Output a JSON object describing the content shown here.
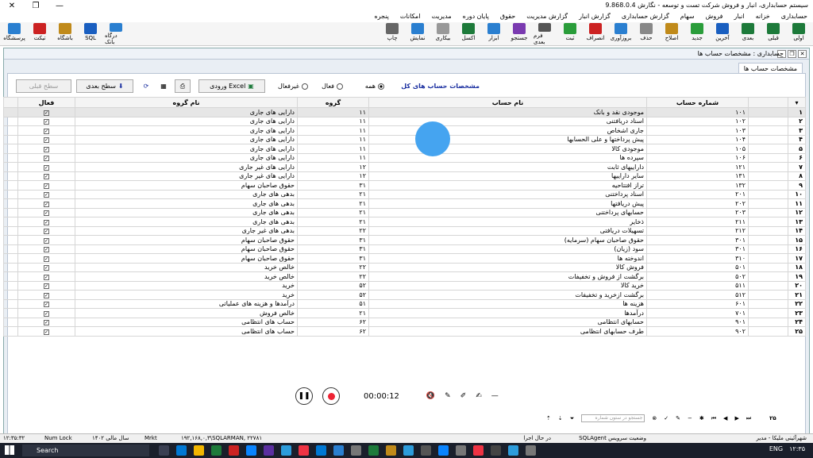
{
  "titlebar": {
    "title": "سیستم حسابداری، انبار و فروش شرکت تست و توسعه - نگارش 9.868.0.4"
  },
  "menu": [
    "حسابداری",
    "خزانه",
    "انبار",
    "فروش",
    "سهام",
    "گزارش حسابداری",
    "گزارش انبار",
    "گزارش مدیریت",
    "حقوق",
    "پایان دوره",
    "مدیریت",
    "امکانات",
    "پنجره"
  ],
  "toolbar": {
    "right": [
      "اولی",
      "قبلی",
      "بعدی",
      "آخرین",
      "جدید",
      "اصلاح",
      "حذف",
      "بروزآوری",
      "انصراف",
      "ثبت",
      "فرم بعدی",
      "جستجو",
      "ابزار",
      "اکسل",
      "بیکاری",
      "نمایش",
      "چاپ"
    ],
    "left": [
      "پرسشگاه",
      "تیکت",
      "باشگاه",
      "SQL",
      "درگاه بانک"
    ]
  },
  "window": {
    "title": "حسابداری : مشخصات حساب ها",
    "tab": "مشخصات حساب ها"
  },
  "options": {
    "header_link": "مشخصات حساب های کل",
    "all": "همه",
    "active": "فعال",
    "inactive": "غیرفعال",
    "import_excel": "ورودی Excel",
    "next_level": "سطح بعدی",
    "prev_level": "سطح قبلی"
  },
  "columns": {
    "account_no": "شماره حساب",
    "account_name": "نام حساب",
    "group": "گروه",
    "group_name": "نام گروه",
    "active": "فعال"
  },
  "rows": [
    {
      "n": "۱",
      "code": "۱۰۱",
      "name": "موجودی نقد و بانک",
      "grp": "۱۱",
      "gname": "دارایی های جاری",
      "sel": true
    },
    {
      "n": "۲",
      "code": "۱۰۲",
      "name": "اسناد دریافتنی",
      "grp": "۱۱",
      "gname": "دارایی های جاری"
    },
    {
      "n": "۳",
      "code": "۱۰۳",
      "name": "جاری اشخاص",
      "grp": "۱۱",
      "gname": "دارایی های جاری"
    },
    {
      "n": "۴",
      "code": "۱۰۴",
      "name": "پیش پرداختها و علی الحسابها",
      "grp": "۱۱",
      "gname": "دارایی های جاری"
    },
    {
      "n": "۵",
      "code": "۱۰۵",
      "name": "موجودی کالا",
      "grp": "۱۱",
      "gname": "دارایی های جاری"
    },
    {
      "n": "۶",
      "code": "۱۰۶",
      "name": "سپرده ها",
      "grp": "۱۱",
      "gname": "دارایی های جاری"
    },
    {
      "n": "۷",
      "code": "۱۲۱",
      "name": "داراییهای ثابت",
      "grp": "۱۲",
      "gname": "دارایی های غیر جاری"
    },
    {
      "n": "۸",
      "code": "۱۳۱",
      "name": "سایر داراییها",
      "grp": "۱۲",
      "gname": "دارایی های غیر جاری"
    },
    {
      "n": "۹",
      "code": "۱۳۲",
      "name": "تراز افتتاحیه",
      "grp": "۳۱",
      "gname": "حقوق صاحبان سهام"
    },
    {
      "n": "۱۰",
      "code": "۲۰۱",
      "name": "اسناد پرداختنی",
      "grp": "۲۱",
      "gname": "بدهی های جاری"
    },
    {
      "n": "۱۱",
      "code": "۲۰۲",
      "name": "پیش دریافتها",
      "grp": "۲۱",
      "gname": "بدهی های جاری"
    },
    {
      "n": "۱۲",
      "code": "۲۰۳",
      "name": "حسابهای پرداختنی",
      "grp": "۲۱",
      "gname": "بدهی های جاری"
    },
    {
      "n": "۱۳",
      "code": "۲۱۱",
      "name": "ذخایر",
      "grp": "۲۱",
      "gname": "بدهی های جاری"
    },
    {
      "n": "۱۴",
      "code": "۲۱۲",
      "name": "تسهیلات دریافتی",
      "grp": "۲۲",
      "gname": "بدهی های غیر جاری"
    },
    {
      "n": "۱۵",
      "code": "۳۰۱",
      "name": "حقوق صاحبان سهام (سرمایه)",
      "grp": "۳۱",
      "gname": "حقوق صاحبان سهام"
    },
    {
      "n": "۱۶",
      "code": "۳۰۱",
      "name": "سود (زیان)",
      "grp": "۳۱",
      "gname": "حقوق صاحبان سهام"
    },
    {
      "n": "۱۷",
      "code": "۳۱۰",
      "name": "اندوخته ها",
      "grp": "۳۱",
      "gname": "حقوق صاحبان سهام"
    },
    {
      "n": "۱۸",
      "code": "۵۰۱",
      "name": "فروش کالا",
      "grp": "۲۲",
      "gname": "خالص خرید"
    },
    {
      "n": "۱۹",
      "code": "۵۰۲",
      "name": "برگشت از فروش و تخفیفات",
      "grp": "۲۲",
      "gname": "خالص خرید"
    },
    {
      "n": "۲۰",
      "code": "۵۱۱",
      "name": "خرید کالا",
      "grp": "۵۲",
      "gname": "خرید"
    },
    {
      "n": "۲۱",
      "code": "۵۱۲",
      "name": "برگشت ازخرید و تخفیفات",
      "grp": "۵۲",
      "gname": "خرید"
    },
    {
      "n": "۲۲",
      "code": "۶۰۱",
      "name": "هزینه ها",
      "grp": "۵۱",
      "gname": "درآمدها و هزینه های عملیاتی"
    },
    {
      "n": "۲۳",
      "code": "۷۰۱",
      "name": "درآمدها",
      "grp": "۲۱",
      "gname": "خالص فروش"
    },
    {
      "n": "۲۴",
      "code": "۹۰۱",
      "name": "حسابهای انتظامی",
      "grp": "۶۲",
      "gname": "حساب های انتظامی"
    },
    {
      "n": "۲۵",
      "code": "۹۰۲",
      "name": "طرف حسابهای انتظامی",
      "grp": "۶۲",
      "gname": "حساب های انتظامی"
    }
  ],
  "player": {
    "time": "00:00:12"
  },
  "nav": {
    "count": "۲۵",
    "search_placeholder": "جستجو در ستون شماره"
  },
  "status": {
    "user": "شهرآئینی ملیکا - مدیر",
    "sql": "SQLAgent وضعیت سرویس",
    "run": "در حال اجرا",
    "server": "۱۹۲,۱۶۸,۰,۳\\SQLARMAN, ۲۲۷۸۱",
    "mrkt": "Mrkt",
    "year": "سال مالی ۱۴۰۲",
    "numlock": "Num Lock",
    "clock": "۱۲:۳۵:۳۲"
  },
  "taskbar": {
    "search": "Search",
    "lang": "ENG",
    "time": "۱۲:۳۵"
  },
  "colors": {
    "accent": "#1a2fa0",
    "cursor": "#45a4f0"
  }
}
